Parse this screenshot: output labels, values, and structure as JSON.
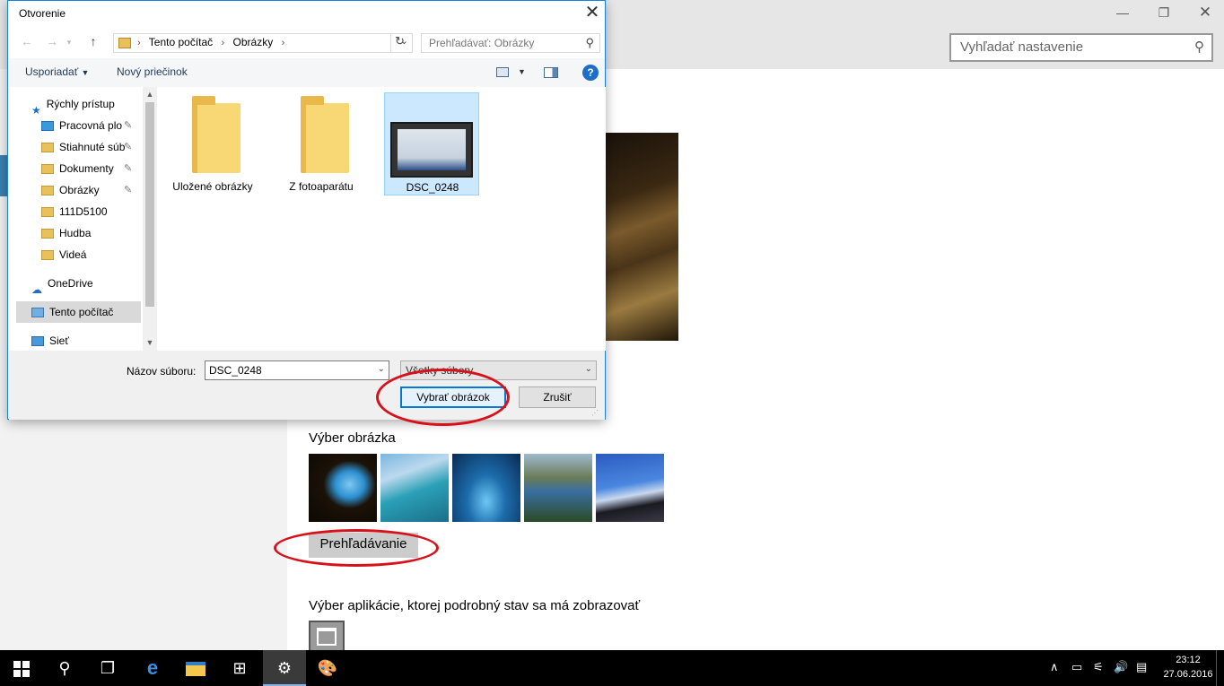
{
  "settings": {
    "search_placeholder": "Vyhľadať nastavenie",
    "picture_section_title": "Výber obrázka",
    "browse_label": "Prehľadávanie",
    "app_section_title": "Výber aplikácie, ktorej podrobný stav sa má zobrazovať"
  },
  "dialog": {
    "title": "Otvorenie",
    "breadcrumb": [
      "Tento počítač",
      "Obrázky"
    ],
    "search_placeholder": "Prehľadávať: Obrázky",
    "organize_label": "Usporiadať",
    "new_folder_label": "Nový priečinok",
    "nav_items": [
      {
        "label": "Rýchly prístup"
      },
      {
        "label": "Pracovná plo"
      },
      {
        "label": "Stiahnuté súb"
      },
      {
        "label": "Dokumenty"
      },
      {
        "label": "Obrázky"
      },
      {
        "label": "111D5100"
      },
      {
        "label": "Hudba"
      },
      {
        "label": "Videá"
      },
      {
        "label": "OneDrive"
      },
      {
        "label": "Tento počítač"
      },
      {
        "label": "Sieť"
      }
    ],
    "files": [
      {
        "name": "Uložené obrázky",
        "type": "folder"
      },
      {
        "name": "Z fotoaparátu",
        "type": "folder"
      },
      {
        "name": "DSC_0248",
        "type": "image"
      }
    ],
    "filename_label": "Názov súboru:",
    "filename_value": "DSC_0248",
    "filetype_value": "Všetky súbory",
    "open_button": "Vybrať obrázok",
    "cancel_button": "Zrušiť"
  },
  "taskbar": {
    "time": "23:12",
    "date": "27.06.2016"
  },
  "colors": {
    "accent": "#0078d7",
    "highlight_ellipse": "#d8101a"
  }
}
